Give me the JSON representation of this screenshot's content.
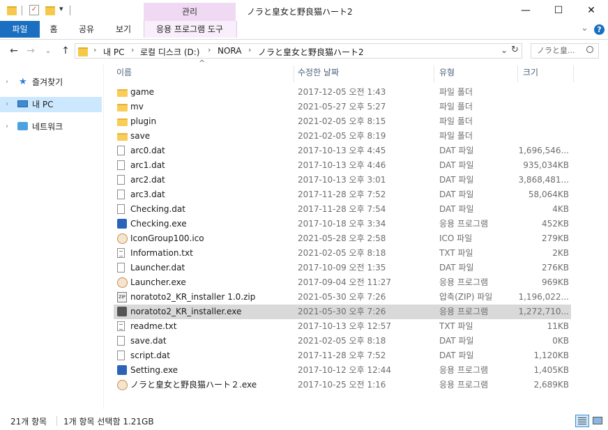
{
  "titlebar": {
    "context_tab": "관리",
    "window_title": "ノラと皇女と野良猫ハート2",
    "minimize": "—",
    "maximize": "☐",
    "close": "✕"
  },
  "ribbon": {
    "tabs": [
      {
        "label": "파일"
      },
      {
        "label": "홈"
      },
      {
        "label": "공유"
      },
      {
        "label": "보기"
      },
      {
        "label": "응용 프로그램 도구"
      }
    ],
    "expand_icon": "⌄",
    "help_icon": "?"
  },
  "address": {
    "crumbs": [
      "내 PC",
      "로컬 디스크 (D:)",
      "NORA",
      "ノラと皇女と野良猫ハート2"
    ],
    "search_placeholder": "ノラと皇...",
    "back": "←",
    "forward": "→",
    "recent": "⌄",
    "up": "↑",
    "refresh": "↻",
    "dropdown": "⌄"
  },
  "nav": {
    "items": [
      {
        "label": "즐겨찾기",
        "icon": "star-icon"
      },
      {
        "label": "내 PC",
        "icon": "pc-icon",
        "selected": true
      },
      {
        "label": "네트워크",
        "icon": "network-icon"
      }
    ]
  },
  "columns": {
    "name": "이름",
    "date": "수정한 날짜",
    "type": "유형",
    "size": "크기",
    "sort_indicator": "^"
  },
  "files": [
    {
      "name": "game",
      "date": "2017-12-05 오전 1:43",
      "type": "파일 폴더",
      "size": "",
      "icon": "folder"
    },
    {
      "name": "mv",
      "date": "2021-05-27 오후 5:27",
      "type": "파일 폴더",
      "size": "",
      "icon": "folder"
    },
    {
      "name": "plugin",
      "date": "2021-02-05 오후 8:15",
      "type": "파일 폴더",
      "size": "",
      "icon": "folder"
    },
    {
      "name": "save",
      "date": "2021-02-05 오후 8:19",
      "type": "파일 폴더",
      "size": "",
      "icon": "folder"
    },
    {
      "name": "arc0.dat",
      "date": "2017-10-13 오후 4:45",
      "type": "DAT 파일",
      "size": "1,696,546...",
      "icon": "file"
    },
    {
      "name": "arc1.dat",
      "date": "2017-10-13 오후 4:46",
      "type": "DAT 파일",
      "size": "935,034KB",
      "icon": "file"
    },
    {
      "name": "arc2.dat",
      "date": "2017-10-13 오후 3:01",
      "type": "DAT 파일",
      "size": "3,868,481...",
      "icon": "file"
    },
    {
      "name": "arc3.dat",
      "date": "2017-11-28 오후 7:52",
      "type": "DAT 파일",
      "size": "58,064KB",
      "icon": "file"
    },
    {
      "name": "Checking.dat",
      "date": "2017-11-28 오후 7:54",
      "type": "DAT 파일",
      "size": "4KB",
      "icon": "file"
    },
    {
      "name": "Checking.exe",
      "date": "2017-10-18 오후 3:34",
      "type": "응용 프로그램",
      "size": "452KB",
      "icon": "exe"
    },
    {
      "name": "IconGroup100.ico",
      "date": "2021-05-28 오후 2:58",
      "type": "ICO 파일",
      "size": "279KB",
      "icon": "app"
    },
    {
      "name": "Information.txt",
      "date": "2021-02-05 오후 8:18",
      "type": "TXT 파일",
      "size": "2KB",
      "icon": "txt"
    },
    {
      "name": "Launcher.dat",
      "date": "2017-10-09 오전 1:35",
      "type": "DAT 파일",
      "size": "276KB",
      "icon": "file"
    },
    {
      "name": "Launcher.exe",
      "date": "2017-09-04 오전 11:27",
      "type": "응용 프로그램",
      "size": "969KB",
      "icon": "app"
    },
    {
      "name": "noratoto2_KR_installer 1.0.zip",
      "date": "2021-05-30 오후 7:26",
      "type": "압축(ZIP) 파일",
      "size": "1,196,022...",
      "icon": "zip"
    },
    {
      "name": "noratoto2_KR_installer.exe",
      "date": "2021-05-30 오후 7:26",
      "type": "응용 프로그램",
      "size": "1,272,710...",
      "icon": "inst",
      "selected": true
    },
    {
      "name": "readme.txt",
      "date": "2017-10-13 오후 12:57",
      "type": "TXT 파일",
      "size": "11KB",
      "icon": "txt"
    },
    {
      "name": "save.dat",
      "date": "2021-02-05 오후 8:18",
      "type": "DAT 파일",
      "size": "0KB",
      "icon": "file"
    },
    {
      "name": "script.dat",
      "date": "2017-11-28 오후 7:52",
      "type": "DAT 파일",
      "size": "1,120KB",
      "icon": "file"
    },
    {
      "name": "Setting.exe",
      "date": "2017-10-12 오후 12:44",
      "type": "응용 프로그램",
      "size": "1,405KB",
      "icon": "exe"
    },
    {
      "name": "ノラと皇女と野良猫ハート２.exe",
      "date": "2017-10-25 오전 1:16",
      "type": "응용 프로그램",
      "size": "2,689KB",
      "icon": "app"
    }
  ],
  "status": {
    "count": "21개 항목",
    "selection": "1개 항목 선택함 1.21GB"
  },
  "colors": {
    "file_tab": "#1a6fc1",
    "context_tab": "#efd9f3",
    "nav_selected": "#cce8ff",
    "row_selected": "#d9d9d9"
  }
}
